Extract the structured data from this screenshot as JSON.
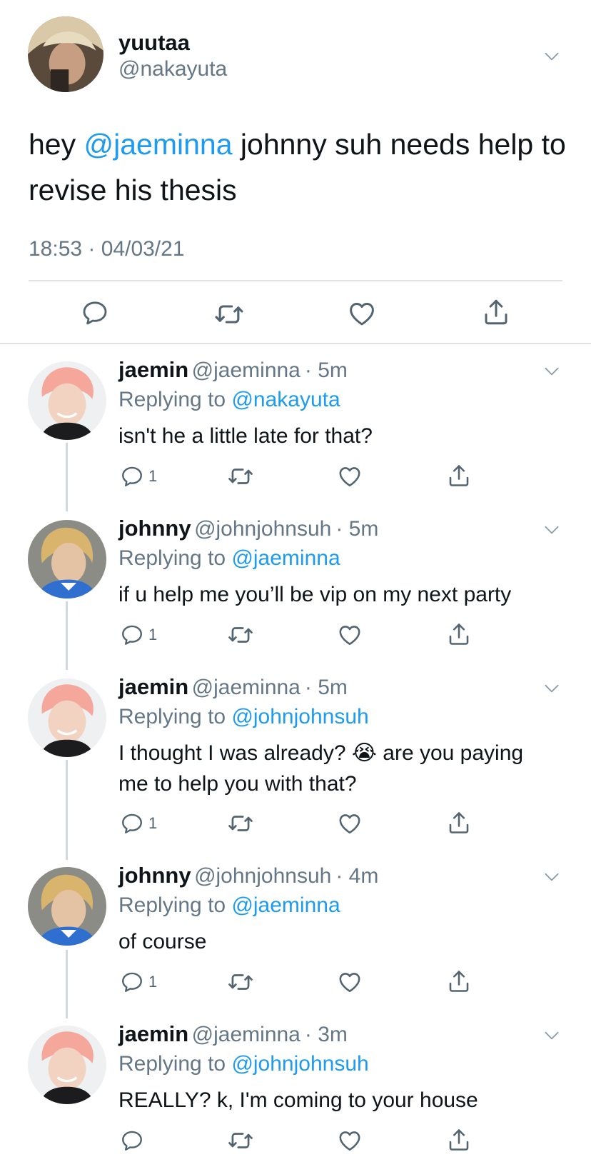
{
  "tweet": {
    "display_name": "yuutaa",
    "handle": "@nakayuta",
    "text_pre": "hey ",
    "mention": "@jaeminna",
    "text_post": " johnny suh needs help to revise his thesis",
    "timestamp": "18:53 · 04/03/21"
  },
  "replies": [
    {
      "display_name": "jaemin",
      "handle": "@jaeminna",
      "time": "· 5m",
      "replying_label": "Replying to ",
      "replying_to": "@nakayuta",
      "text": "isn't he a little late for that?",
      "reply_count": "1"
    },
    {
      "display_name": "johnny",
      "handle": "@johnjohnsuh",
      "time": "· 5m",
      "replying_label": "Replying to ",
      "replying_to": "@jaeminna",
      "text": "if u help me you’ll be vip on my next party",
      "reply_count": "1"
    },
    {
      "display_name": "jaemin",
      "handle": "@jaeminna",
      "time": "· 5m",
      "replying_label": "Replying to ",
      "replying_to": "@johnjohnsuh",
      "text_line1_pre": "I thought I was already?",
      "emoji": "😭",
      "text_line1_post": "are you paying",
      "text_line2": "me to help you with that?",
      "reply_count": "1"
    },
    {
      "display_name": "johnny",
      "handle": "@johnjohnsuh",
      "time": "· 4m",
      "replying_label": "Replying to ",
      "replying_to": "@jaeminna",
      "text": "of course",
      "reply_count": "1"
    },
    {
      "display_name": "jaemin",
      "handle": "@jaeminna",
      "time": "· 3m",
      "replying_label": "Replying to ",
      "replying_to": "@johnjohnsuh",
      "text": "REALLY? k, I'm coming to your house",
      "reply_count": ""
    }
  ],
  "icons": {
    "reply": "reply-icon",
    "retweet": "retweet-icon",
    "like": "like-icon",
    "share": "share-icon",
    "more": "chevron-down-icon"
  },
  "colors": {
    "link": "#1d9bf0",
    "secondary_text": "#657786",
    "icon": "#536471",
    "divider": "#dfe3e6",
    "thread_line": "#cfd9de"
  }
}
